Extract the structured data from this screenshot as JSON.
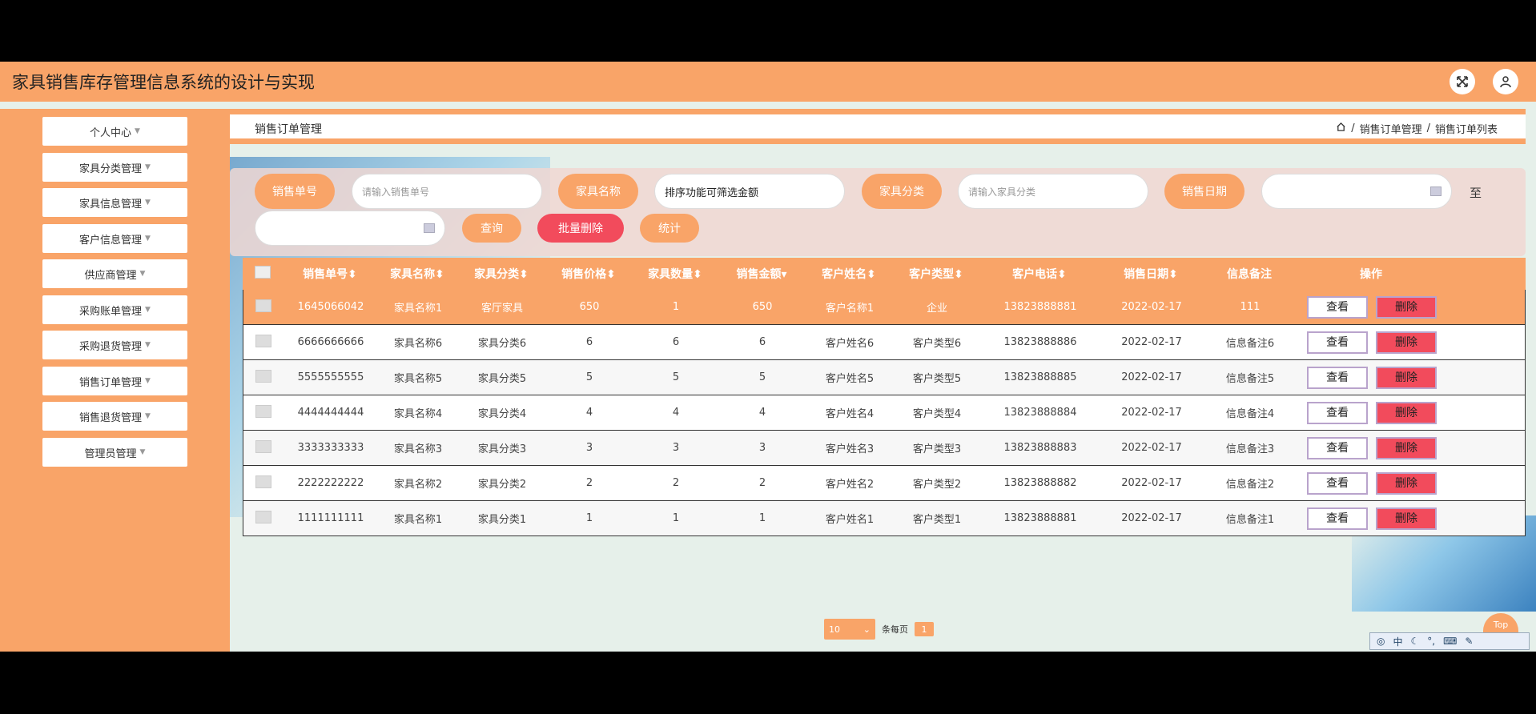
{
  "app": {
    "title": "家具销售库存管理信息系统的设计与实现"
  },
  "sidebar": {
    "items": [
      {
        "label": "个人中心"
      },
      {
        "label": "家具分类管理"
      },
      {
        "label": "家具信息管理"
      },
      {
        "label": "客户信息管理"
      },
      {
        "label": "供应商管理"
      },
      {
        "label": "采购账单管理"
      },
      {
        "label": "采购退货管理"
      },
      {
        "label": "销售订单管理"
      },
      {
        "label": "销售退货管理"
      },
      {
        "label": "管理员管理"
      }
    ]
  },
  "page": {
    "title": "销售订单管理",
    "breadcrumb": [
      "销售订单管理",
      "销售订单列表"
    ],
    "breadcrumb_sep": "/"
  },
  "search": {
    "order_no_label": "销售单号",
    "order_no_placeholder": "请输入销售单号",
    "furniture_name_label": "家具名称",
    "furniture_name_value": "排序功能可筛选金额",
    "category_label": "家具分类",
    "category_placeholder": "请输入家具分类",
    "date_label": "销售日期",
    "date_to": "至",
    "query_btn": "查询",
    "batch_delete_btn": "批量删除",
    "stats_btn": "统计"
  },
  "table": {
    "headers": [
      "销售单号",
      "家具名称",
      "家具分类",
      "销售价格",
      "家具数量",
      "销售金额",
      "客户姓名",
      "客户类型",
      "客户电话",
      "销售日期",
      "信息备注",
      "操作"
    ],
    "view_label": "查看",
    "delete_label": "删除",
    "rows": [
      [
        "1645066042",
        "家具名称1",
        "客厅家具",
        "650",
        "1",
        "650",
        "客户名称1",
        "企业",
        "13823888881",
        "2022-02-17",
        "111"
      ],
      [
        "6666666666",
        "家具名称6",
        "家具分类6",
        "6",
        "6",
        "6",
        "客户姓名6",
        "客户类型6",
        "13823888886",
        "2022-02-17",
        "信息备注6"
      ],
      [
        "5555555555",
        "家具名称5",
        "家具分类5",
        "5",
        "5",
        "5",
        "客户姓名5",
        "客户类型5",
        "13823888885",
        "2022-02-17",
        "信息备注5"
      ],
      [
        "4444444444",
        "家具名称4",
        "家具分类4",
        "4",
        "4",
        "4",
        "客户姓名4",
        "客户类型4",
        "13823888884",
        "2022-02-17",
        "信息备注4"
      ],
      [
        "3333333333",
        "家具名称3",
        "家具分类3",
        "3",
        "3",
        "3",
        "客户姓名3",
        "客户类型3",
        "13823888883",
        "2022-02-17",
        "信息备注3"
      ],
      [
        "2222222222",
        "家具名称2",
        "家具分类2",
        "2",
        "2",
        "2",
        "客户姓名2",
        "客户类型2",
        "13823888882",
        "2022-02-17",
        "信息备注2"
      ],
      [
        "1111111111",
        "家具名称1",
        "家具分类1",
        "1",
        "1",
        "1",
        "客户姓名1",
        "客户类型1",
        "13823888881",
        "2022-02-17",
        "信息备注1"
      ]
    ]
  },
  "pagination": {
    "page_size": "10",
    "per_page_label": "条每页",
    "current_page": "1"
  },
  "misc": {
    "top_label": "Top",
    "ime_lang": "中"
  },
  "colors": {
    "primary": "#f9a468",
    "danger": "#f24b5c"
  }
}
